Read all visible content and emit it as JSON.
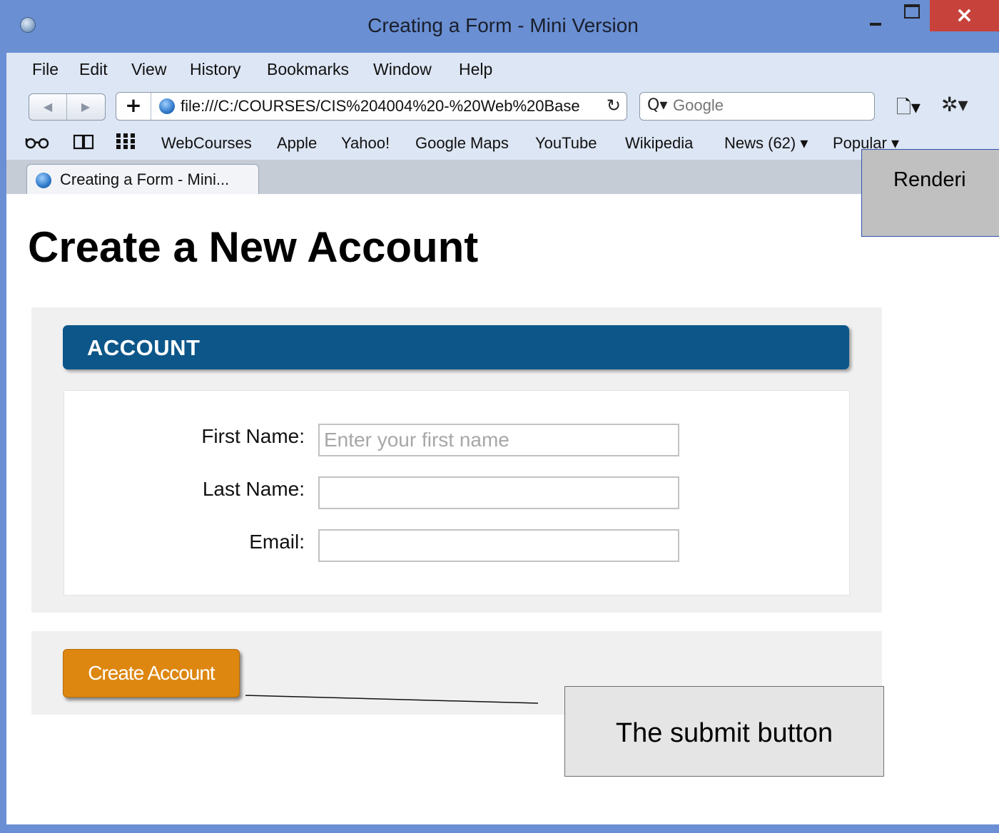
{
  "window": {
    "title": "Creating a Form - Mini Version",
    "close_label": "×"
  },
  "menu": [
    "File",
    "Edit",
    "View",
    "History",
    "Bookmarks",
    "Window",
    "Help"
  ],
  "nav": {
    "back_glyph": "◀",
    "forward_glyph": "▶",
    "add_glyph": "+",
    "url": "file:///C:/COURSES/CIS%204004%20-%20Web%20Base",
    "reload_glyph": "↻",
    "search_placeholder": "Google",
    "search_icon": "Q▾",
    "page_menu_glyph": "🗋▾",
    "settings_glyph": "✲▾"
  },
  "bookmarks": {
    "icons": [
      "reading-glasses-icon",
      "book-icon",
      "grid-icon"
    ],
    "items": [
      "WebCourses",
      "Apple",
      "Yahoo!",
      "Google Maps",
      "YouTube",
      "Wikipedia",
      "News (62) ▾",
      "Popular ▾"
    ]
  },
  "tab": {
    "label": "Creating a Form - Mini..."
  },
  "page": {
    "heading": "Create a New Account",
    "section_title": "ACCOUNT",
    "fields": [
      {
        "label": "First Name:",
        "value": "",
        "placeholder": "Enter your first name"
      },
      {
        "label": "Last Name:",
        "value": "",
        "placeholder": ""
      },
      {
        "label": "Email:",
        "value": "",
        "placeholder": ""
      }
    ],
    "submit_label": "Create Account"
  },
  "annotations": {
    "submit_callout": "The submit button",
    "render_callout": "Renderi"
  },
  "colors": {
    "title_bar": "#6a8fd3",
    "close_button": "#c7423b",
    "section_header": "#0c5689",
    "submit_button": "#dd8711"
  }
}
